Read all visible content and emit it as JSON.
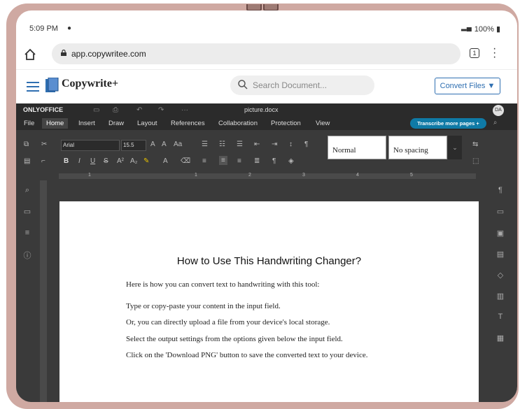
{
  "status_bar": {
    "time": "5:09 PM",
    "battery": "100%"
  },
  "browser": {
    "url": "app.copywritee.com",
    "tab_count": "1"
  },
  "site": {
    "brand": "Copywrite+",
    "search_placeholder": "Search Document...",
    "convert_button": "Convert Files ▼"
  },
  "editor": {
    "app_name": "ONLYOFFICE",
    "filename": "picture.docx",
    "avatar": "DA",
    "menu": [
      "File",
      "Home",
      "Insert",
      "Draw",
      "Layout",
      "References",
      "Collaboration",
      "Protection",
      "View"
    ],
    "active_menu": "Home",
    "transcribe_button": "Transcribe more pages +",
    "font": "Arial",
    "font_size": "15.5",
    "styles": {
      "normal": "Normal",
      "no_spacing": "No spacing"
    },
    "ruler_numbers": [
      "1",
      "1",
      "2",
      "3",
      "4",
      "5"
    ]
  },
  "document": {
    "title": "How to Use This Handwriting Changer?",
    "lines": [
      "Here is how you can convert text to handwriting with this tool:",
      "Type or copy-paste your content in the input field.",
      "Or, you can directly upload a file from your device's local storage.",
      "Select the output settings from the options given below the input field.",
      "Click on the 'Download PNG' button to save the converted text to your device."
    ]
  },
  "colors": {
    "frame": "#cfa9a2",
    "brand_blue": "#2f6fb1",
    "editor_dark": "#3a3a3a",
    "transcribe": "#0f7aa6"
  }
}
